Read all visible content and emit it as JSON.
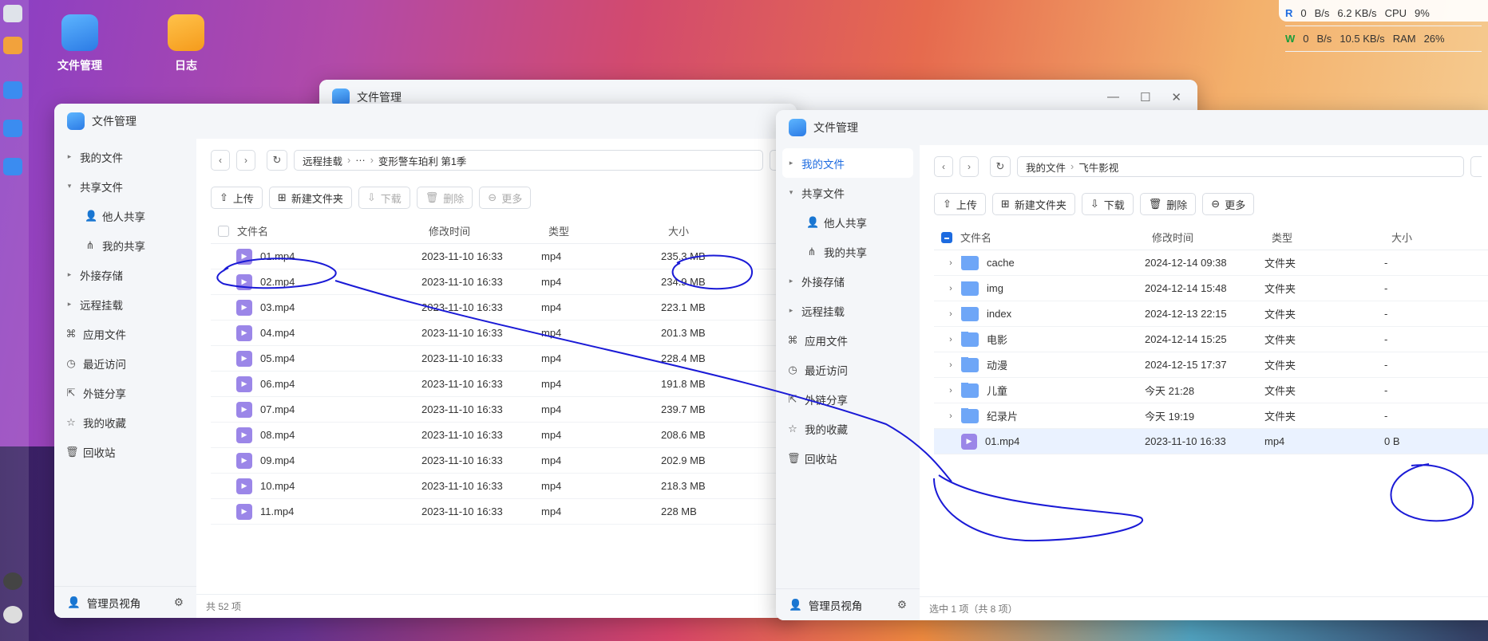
{
  "tray": {
    "r_label": "R",
    "w_label": "W",
    "r_up": "0",
    "w_up": "0",
    "unit_up": "B/s",
    "down_r": "6.2 KB/s",
    "down_w": "10.5 KB/s",
    "cpu_label": "CPU",
    "ram_label": "RAM",
    "cpu": "9%",
    "ram": "26%"
  },
  "desktop": {
    "file_manager": "文件管理",
    "log": "日志"
  },
  "back_window": {
    "title": "文件管理"
  },
  "left_window": {
    "title": "文件管理",
    "sidebar": {
      "my_files": "我的文件",
      "shared": "共享文件",
      "others_share": "他人共享",
      "my_share": "我的共享",
      "external": "外接存储",
      "remote": "远程挂载",
      "apps": "应用文件",
      "recent": "最近访问",
      "link_share": "外链分享",
      "favorites": "我的收藏",
      "trash": "回收站",
      "admin": "管理员视角"
    },
    "breadcrumb": [
      "远程挂载",
      "···",
      "变形警车珀利 第1季"
    ],
    "toolbar": {
      "upload": "上传",
      "new_folder": "新建文件夹",
      "download": "下载",
      "delete": "删除",
      "more": "更多"
    },
    "columns": {
      "name": "文件名",
      "modified": "修改时间",
      "type": "类型",
      "size": "大小"
    },
    "rows": [
      {
        "name": "01.mp4",
        "modified": "2023-11-10 16:33",
        "type": "mp4",
        "size": "235.3 MB"
      },
      {
        "name": "02.mp4",
        "modified": "2023-11-10 16:33",
        "type": "mp4",
        "size": "234.9 MB"
      },
      {
        "name": "03.mp4",
        "modified": "2023-11-10 16:33",
        "type": "mp4",
        "size": "223.1 MB"
      },
      {
        "name": "04.mp4",
        "modified": "2023-11-10 16:33",
        "type": "mp4",
        "size": "201.3 MB"
      },
      {
        "name": "05.mp4",
        "modified": "2023-11-10 16:33",
        "type": "mp4",
        "size": "228.4 MB"
      },
      {
        "name": "06.mp4",
        "modified": "2023-11-10 16:33",
        "type": "mp4",
        "size": "191.8 MB"
      },
      {
        "name": "07.mp4",
        "modified": "2023-11-10 16:33",
        "type": "mp4",
        "size": "239.7 MB"
      },
      {
        "name": "08.mp4",
        "modified": "2023-11-10 16:33",
        "type": "mp4",
        "size": "208.6 MB"
      },
      {
        "name": "09.mp4",
        "modified": "2023-11-10 16:33",
        "type": "mp4",
        "size": "202.9 MB"
      },
      {
        "name": "10.mp4",
        "modified": "2023-11-10 16:33",
        "type": "mp4",
        "size": "218.3 MB"
      },
      {
        "name": "11.mp4",
        "modified": "2023-11-10 16:33",
        "type": "mp4",
        "size": "228 MB"
      }
    ],
    "status": "共 52 项"
  },
  "right_window": {
    "title": "文件管理",
    "sidebar": {
      "my_files": "我的文件",
      "shared": "共享文件",
      "others_share": "他人共享",
      "my_share": "我的共享",
      "external": "外接存储",
      "remote": "远程挂载",
      "apps": "应用文件",
      "recent": "最近访问",
      "link_share": "外链分享",
      "favorites": "我的收藏",
      "trash": "回收站",
      "admin": "管理员视角"
    },
    "breadcrumb": [
      "我的文件",
      "飞牛影视"
    ],
    "toolbar": {
      "upload": "上传",
      "new_folder": "新建文件夹",
      "download": "下载",
      "delete": "删除",
      "more": "更多"
    },
    "columns": {
      "name": "文件名",
      "modified": "修改时间",
      "type": "类型",
      "size": "大小"
    },
    "rows": [
      {
        "name": "cache",
        "modified": "2024-12-14 09:38",
        "type": "文件夹",
        "size": "-",
        "kind": "folder"
      },
      {
        "name": "img",
        "modified": "2024-12-14 15:48",
        "type": "文件夹",
        "size": "-",
        "kind": "folder"
      },
      {
        "name": "index",
        "modified": "2024-12-13 22:15",
        "type": "文件夹",
        "size": "-",
        "kind": "folder"
      },
      {
        "name": "电影",
        "modified": "2024-12-14 15:25",
        "type": "文件夹",
        "size": "-",
        "kind": "folder"
      },
      {
        "name": "动漫",
        "modified": "2024-12-15 17:37",
        "type": "文件夹",
        "size": "-",
        "kind": "folder"
      },
      {
        "name": "儿童",
        "modified": "今天 21:28",
        "type": "文件夹",
        "size": "-",
        "kind": "folder"
      },
      {
        "name": "纪录片",
        "modified": "今天 19:19",
        "type": "文件夹",
        "size": "-",
        "kind": "folder"
      },
      {
        "name": "01.mp4",
        "modified": "2023-11-10 16:33",
        "type": "mp4",
        "size": "0 B",
        "kind": "video"
      }
    ],
    "status": "选中 1 项（共 8 项）"
  },
  "colors": {
    "accent": "#1d6be0",
    "annotation": "#1a1ad6"
  }
}
